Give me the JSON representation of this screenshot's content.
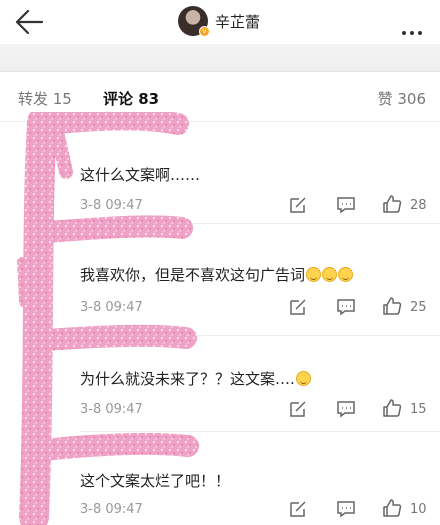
{
  "header": {
    "user_name": "辛芷蕾",
    "back_icon": "back-arrow-icon",
    "more_icon": "more-dots-icon"
  },
  "tabs": {
    "repost": "转发 15",
    "comments": "评论 83",
    "likes": "赞 306",
    "accent_color": "#ff8200"
  },
  "comments": [
    {
      "text": "这什么文案啊……",
      "time": "3-8 09:47",
      "likes": "28"
    },
    {
      "text": "我喜欢你，但是不喜欢这句广告词",
      "time": "3-8 09:47",
      "likes": "25"
    },
    {
      "text": "为什么就没未来了？？这文案….",
      "time": "3-8 09:47",
      "likes": "15"
    },
    {
      "text": "这个文案太烂了吧！！",
      "time": "3-8 09:47",
      "likes": "10"
    }
  ],
  "colors": {
    "scribble": "#f29cc4",
    "time": "#999999"
  }
}
